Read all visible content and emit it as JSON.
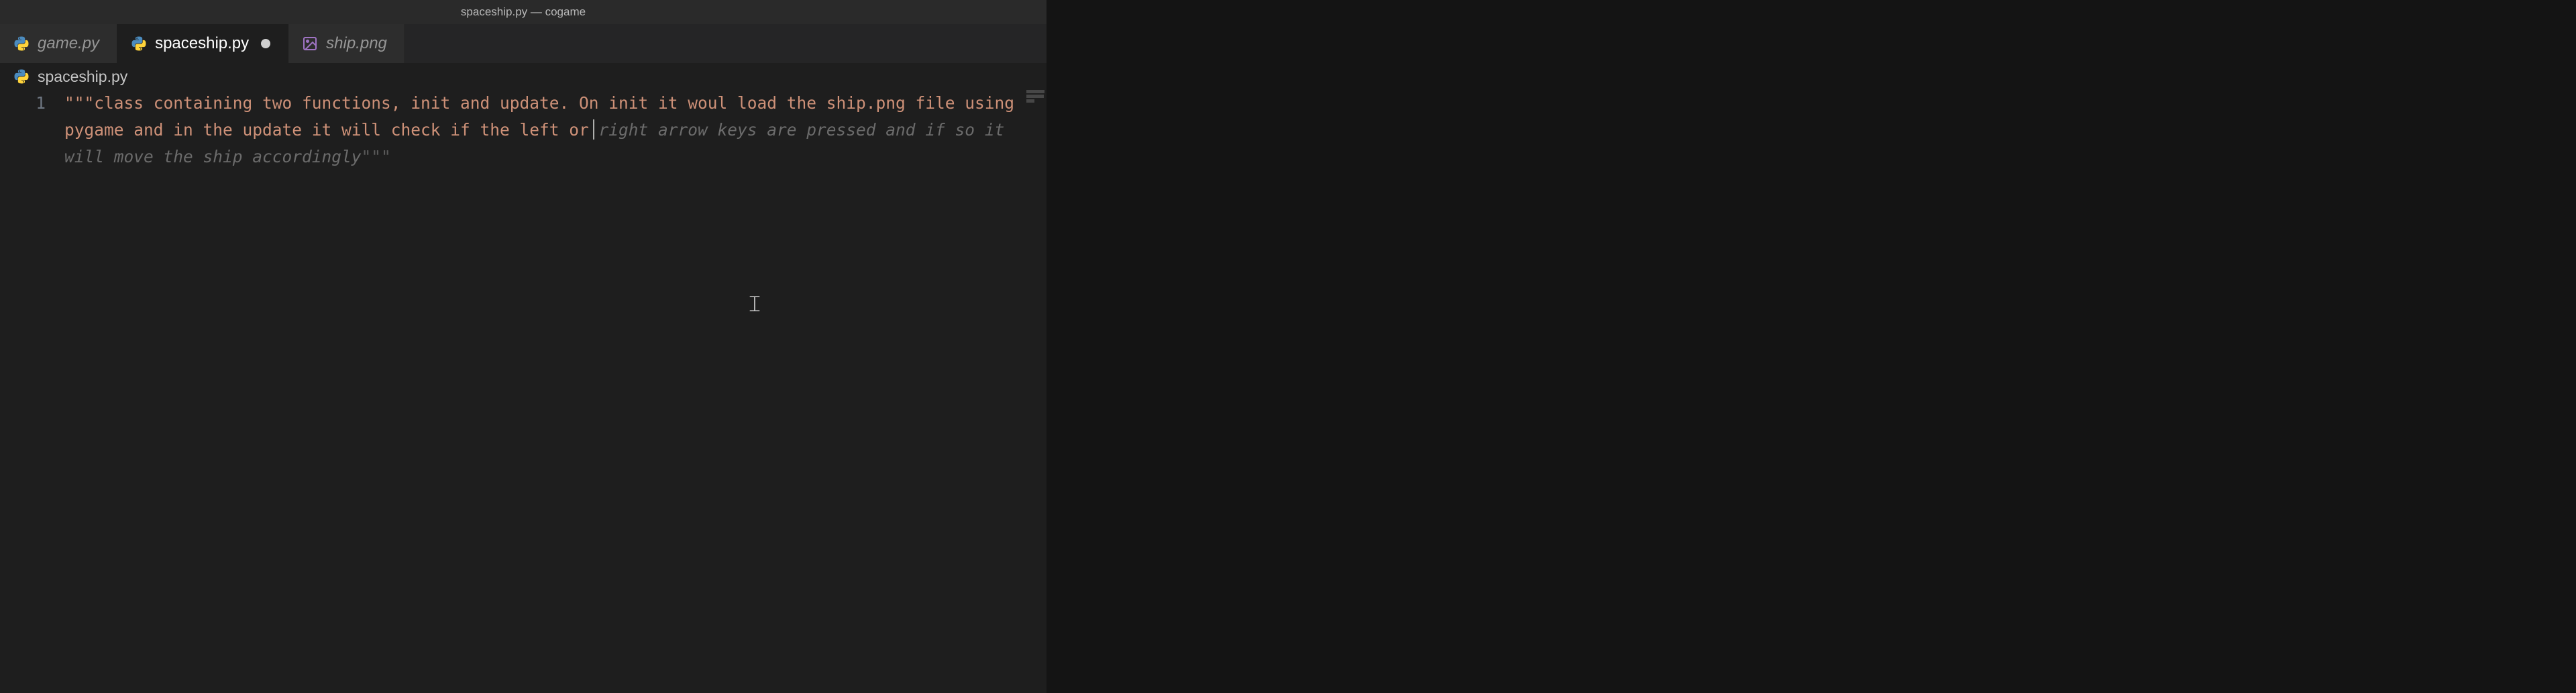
{
  "title_bar": "spaceship.py — cogame",
  "tabs": [
    {
      "label": "game.py",
      "icon": "python",
      "active": false,
      "dirty": false
    },
    {
      "label": "spaceship.py",
      "icon": "python",
      "active": true,
      "dirty": true
    },
    {
      "label": "ship.png",
      "icon": "image",
      "active": false,
      "dirty": false
    }
  ],
  "breadcrumb": {
    "icon": "python",
    "label": "spaceship.py"
  },
  "editor": {
    "line_number": "1",
    "docstring_open": "\"\"\"",
    "typed_text": "class containing two functions, init and update. On init it woul load the ship.png file using pygame and in the update it will check if the left or ",
    "ghost_text": "right arrow keys are pressed and if so it will move the ship accordingly",
    "docstring_close": "\"\"\""
  }
}
